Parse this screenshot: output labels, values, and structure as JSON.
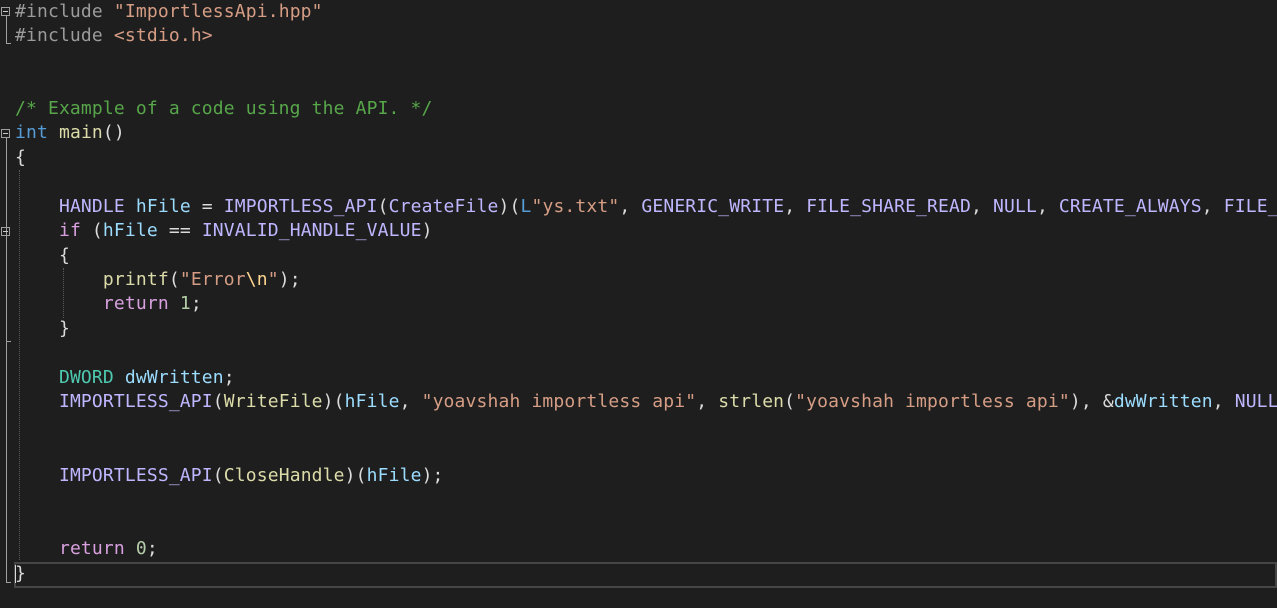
{
  "editor": {
    "colors": {
      "background": "#1e1e1e",
      "text": "#dcdcdc",
      "keyword": "#569cd6",
      "control_keyword": "#d8a0df",
      "function": "#dcdcaa",
      "variable": "#9cdcfe",
      "macro": "#beb7ff",
      "string": "#d69d85",
      "comment": "#57a64a",
      "number": "#b5cea8",
      "type": "#4ec9b0"
    },
    "code": {
      "l1": {
        "directive": "#include",
        "file": "\"ImportlessApi.hpp\""
      },
      "l2": {
        "directive": "#include",
        "file": "<stdio.h>"
      },
      "l5": {
        "comment": "/* Example of a code using the API. */"
      },
      "l6": {
        "kw_int": "int",
        "fn_main": "main",
        "parens": "()"
      },
      "l7": {
        "brace": "{"
      },
      "l9": {
        "handle": "HANDLE",
        "hfile": "hFile",
        "assign": " = ",
        "importless": "IMPORTLESS_API",
        "p1": "(",
        "createfile": "CreateFile",
        "p2": ")(",
        "l_prefix": "L",
        "str_ys": "\"ys.txt\"",
        "c1": ", ",
        "generic_write": "GENERIC_WRITE",
        "c2": ", ",
        "file_share_read": "FILE_SHARE_READ",
        "c3": ", ",
        "null": "NULL",
        "c4": ", ",
        "create_always": "CREATE_ALWAYS",
        "c5": ", ",
        "file_trunc": "FILE_"
      },
      "l10": {
        "kw_if": "if",
        "p1": " (",
        "hfile": "hFile",
        "op": " == ",
        "invalid": "INVALID_HANDLE_VALUE",
        "p2": ")"
      },
      "l11": {
        "brace": "{"
      },
      "l12": {
        "printf": "printf",
        "p1": "(",
        "str_a": "\"Error",
        "esc": "\\n",
        "str_b": "\"",
        "p2": ");"
      },
      "l13": {
        "kw_return": "return",
        "num": "1",
        "semi": ";"
      },
      "l14": {
        "brace": "}"
      },
      "l16": {
        "dword": "DWORD",
        "var": "dwWritten",
        "semi": ";"
      },
      "l17": {
        "importless": "IMPORTLESS_API",
        "p1": "(",
        "writefile": "WriteFile",
        "p2": ")(",
        "hfile": "hFile",
        "c1": ", ",
        "str1": "\"yoavshah importless api\"",
        "c2": ", ",
        "strlen": "strlen",
        "p3": "(",
        "str2": "\"yoavshah importless api\"",
        "p4": "), ",
        "amp": "&",
        "dwwritten": "dwWritten",
        "c3": ", ",
        "null": "NULL"
      },
      "l20": {
        "importless": "IMPORTLESS_API",
        "p1": "(",
        "closehandle": "CloseHandle",
        "p2": ")(",
        "hfile": "hFile",
        "p3": ");"
      },
      "l23": {
        "kw_return": "return",
        "num": "0",
        "semi": ";"
      },
      "l24": {
        "brace": "}"
      }
    }
  }
}
